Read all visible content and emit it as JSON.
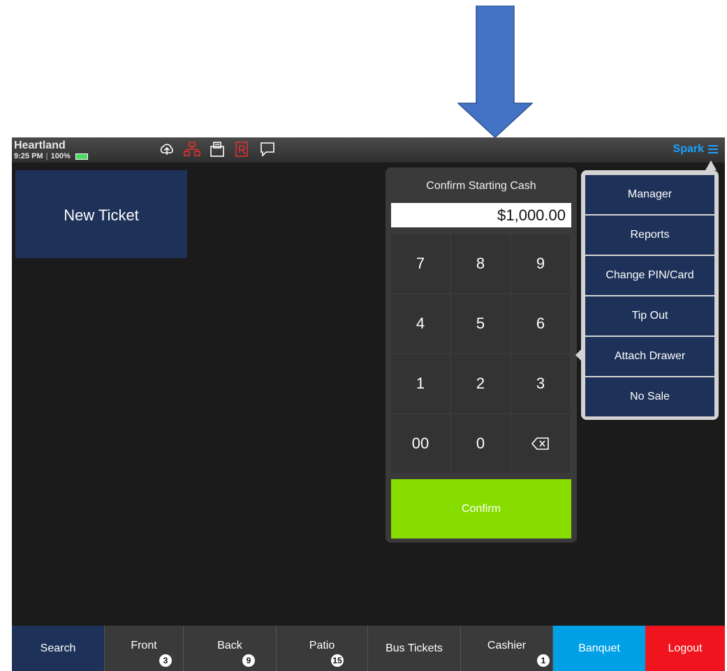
{
  "status_bar": {
    "brand": "Heartland",
    "time": "9:25 PM",
    "battery": "100%",
    "user_menu_label": "Spark",
    "icons": [
      "cloud-upload-icon",
      "network-icon",
      "printer-icon",
      "report-icon",
      "message-icon"
    ]
  },
  "new_ticket_label": "New Ticket",
  "cash_dialog": {
    "title": "Confirm Starting Cash",
    "amount": "$1,000.00",
    "keys": [
      "7",
      "8",
      "9",
      "4",
      "5",
      "6",
      "1",
      "2",
      "3",
      "00",
      "0"
    ],
    "confirm_label": "Confirm"
  },
  "menu": {
    "items": [
      "Manager",
      "Reports",
      "Change PIN/Card",
      "Tip Out",
      "Attach Drawer",
      "No Sale"
    ]
  },
  "bottom_tabs": [
    {
      "label": "Search",
      "badge": ""
    },
    {
      "label": "Front",
      "badge": "3"
    },
    {
      "label": "Back",
      "badge": "9"
    },
    {
      "label": "Patio",
      "badge": "15"
    },
    {
      "label": "Bus Tickets",
      "badge": ""
    },
    {
      "label": "Cashier",
      "badge": "1"
    },
    {
      "label": "Banquet",
      "badge": ""
    },
    {
      "label": "Logout",
      "badge": ""
    }
  ],
  "colors": {
    "tab_default": "#3a3a3a",
    "tab_search": "#1e3158",
    "tab_banquet": "#00a0e6",
    "tab_logout": "#f0141e",
    "confirm": "#88dd00",
    "annotation_arrow": "#4472c4"
  }
}
